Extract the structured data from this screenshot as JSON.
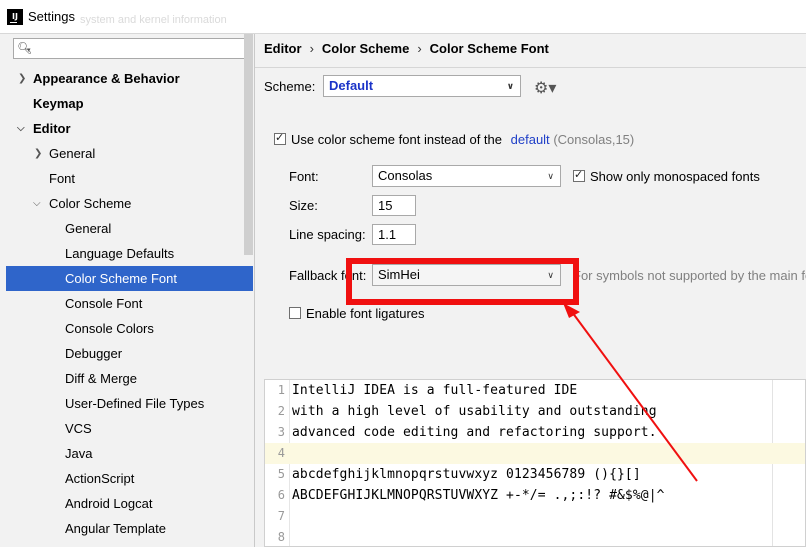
{
  "window": {
    "title": "Settings",
    "ghost_text": "system and kernel information"
  },
  "sidebar": {
    "search_placeholder": "",
    "items": [
      {
        "label": "Appearance & Behavior"
      },
      {
        "label": "Keymap"
      },
      {
        "label": "Editor"
      },
      {
        "label": "General"
      },
      {
        "label": "Font"
      },
      {
        "label": "Color Scheme"
      },
      {
        "label": "General"
      },
      {
        "label": "Language Defaults"
      },
      {
        "label": "Color Scheme Font"
      },
      {
        "label": "Console Font"
      },
      {
        "label": "Console Colors"
      },
      {
        "label": "Debugger"
      },
      {
        "label": "Diff & Merge"
      },
      {
        "label": "User-Defined File Types"
      },
      {
        "label": "VCS"
      },
      {
        "label": "Java"
      },
      {
        "label": "ActionScript"
      },
      {
        "label": "Android Logcat"
      },
      {
        "label": "Angular Template"
      }
    ]
  },
  "breadcrumb": [
    "Editor",
    "Color Scheme",
    "Color Scheme Font"
  ],
  "scheme": {
    "label": "Scheme:",
    "value": "Default"
  },
  "use_scheme_font": {
    "checked": true,
    "label": "Use color scheme font instead of the",
    "link": "default",
    "suffix": "(Consolas,15)"
  },
  "font": {
    "label": "Font:",
    "value": "Consolas"
  },
  "monospaced": {
    "checked": true,
    "label": "Show only monospaced fonts"
  },
  "size": {
    "label": "Size:",
    "value": "15"
  },
  "line_spacing": {
    "label": "Line spacing:",
    "value": "1.1"
  },
  "fallback": {
    "label": "Fallback font:",
    "value": "SimHei",
    "hint": "For symbols not supported by the main font"
  },
  "ligatures": {
    "checked": false,
    "label": "Enable font ligatures"
  },
  "preview": {
    "lines": [
      {
        "num": "1",
        "text": "IntelliJ IDEA is a full-featured IDE"
      },
      {
        "num": "2",
        "text": "with a high level of usability and outstanding"
      },
      {
        "num": "3",
        "text": "advanced code editing and refactoring support."
      },
      {
        "num": "4",
        "text": ""
      },
      {
        "num": "5",
        "text": "abcdefghijklmnopqrstuvwxyz 0123456789 (){}[]"
      },
      {
        "num": "6",
        "text": "ABCDEFGHIJKLMNOPQRSTUVWXYZ +-*/= .,;:!? #&$%@|^"
      },
      {
        "num": "7",
        "text": ""
      },
      {
        "num": "8",
        "text": ""
      }
    ]
  },
  "colors": {
    "selection": "#2f65ca",
    "annotation": "#f01010",
    "link": "#2040c8"
  }
}
